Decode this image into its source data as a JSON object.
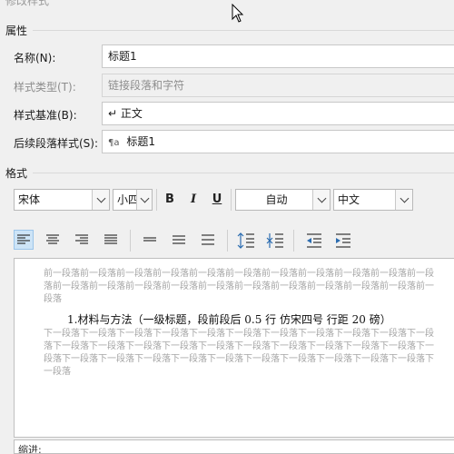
{
  "window": {
    "title": "修改样式"
  },
  "properties": {
    "heading": "属性",
    "name_label": "名称(N):",
    "name_value": "标题1",
    "style_type_label": "样式类型(T):",
    "style_type_value": "链接段落和字符",
    "based_on_label": "样式基准(B):",
    "based_on_value": "↵ 正文",
    "next_style_label": "后续段落样式(S):",
    "next_style_value": "标题1",
    "next_style_icon": "¶a"
  },
  "format": {
    "heading": "格式",
    "font": "宋体",
    "size": "小四",
    "bold": "B",
    "italic": "I",
    "underline": "U",
    "color": "自动",
    "script": "中文"
  },
  "preview": {
    "prev_paragraph": "前一段落前一段落前一段落前一段落前一段落前一段落前一段落前一段落前一段落前一段落前一段落前一段落前一段落前一段落前一段落前一段落前一段落前一段落前一段落前一段落前一段落前一段落",
    "main_line": "1.材料与方法（一级标题，段前段后 0.5 行  仿宋四号  行距 20 磅）",
    "next_paragraph": "下一段落下一段落下一段落下一段落下一段落下一段落下一段落下一段落下一段落下一段落下一段落下一段落下一段落下一段落下一段落下一段落下一段落下一段落下一段落下一段落下一段落下一段落下一段落下一段落下一段落下一段落下一段落下一段落下一段落下一段落下一段落下一段落下一段落"
  },
  "description": {
    "label": "缩进:"
  }
}
